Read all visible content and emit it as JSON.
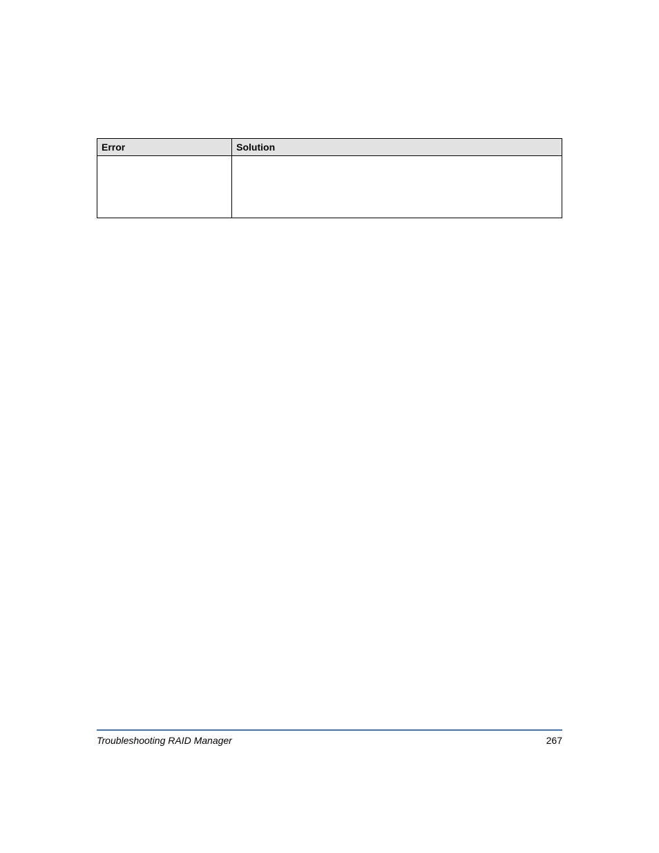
{
  "table": {
    "headers": {
      "error": "Error",
      "solution": "Solution"
    },
    "rows": [
      {
        "error": "",
        "solution": ""
      }
    ]
  },
  "footer": {
    "section": "Troubleshooting RAID Manager",
    "page_number": "267"
  }
}
